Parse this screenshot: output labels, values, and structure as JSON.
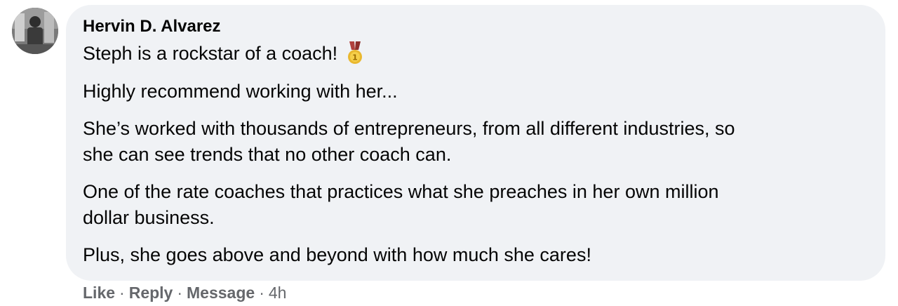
{
  "comment": {
    "author": "Hervin D. Alvarez",
    "paragraphs": [
      "Steph is a rockstar of a coach!",
      "Highly recommend working with her...",
      "She’s worked with thousands of entrepreneurs, from all different industries, so",
      "she can see trends that no other coach can.",
      "One of the rate coaches that practices what she preaches in her own million",
      "dollar business.",
      "Plus, she goes above and beyond with how much she cares!"
    ],
    "emoji": "medal-icon",
    "actions": {
      "like": "Like",
      "reply": "Reply",
      "message": "Message",
      "separator": "·",
      "time": "4h"
    }
  },
  "colors": {
    "bubble": "#f0f2f5",
    "text": "#050505",
    "meta": "#65676b"
  }
}
